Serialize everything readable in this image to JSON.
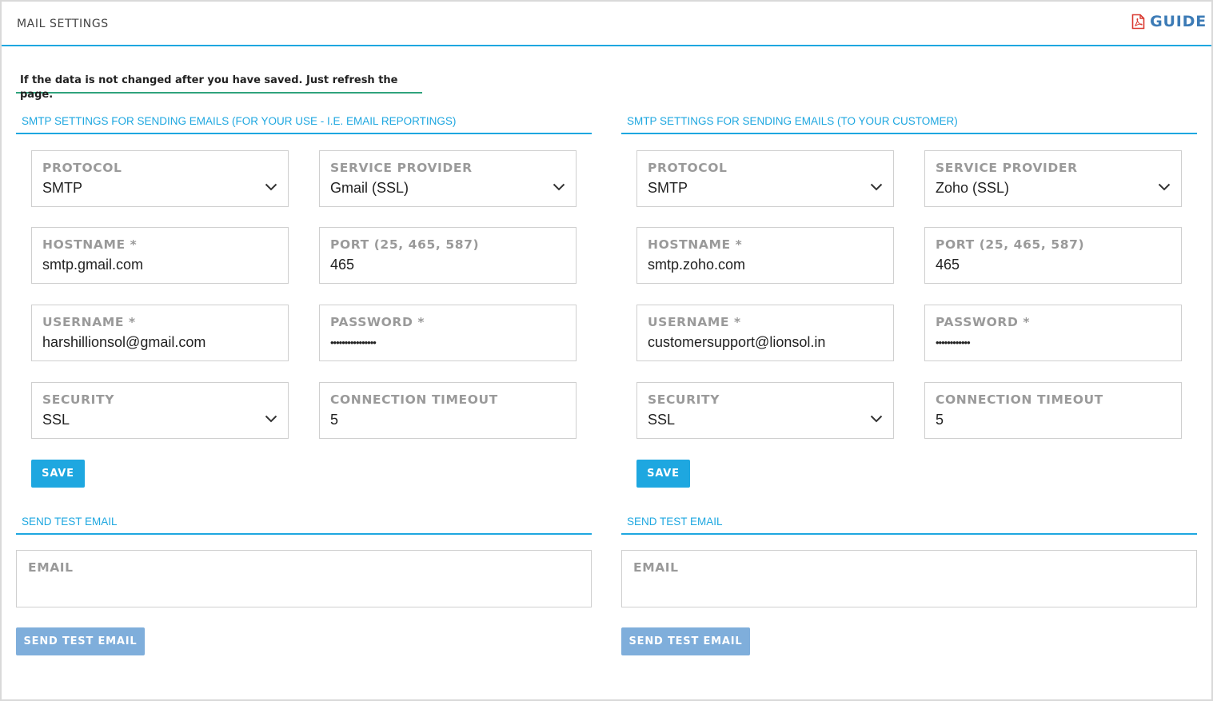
{
  "page": {
    "title": "MAIL SETTINGS",
    "guide_label": "GUIDE",
    "accent": "#1ea7e0",
    "notice_border": "#2fa37c"
  },
  "notice": "If the data is not changed after you have saved. Just refresh the page.",
  "panels": [
    {
      "section_title": "SMTP SETTINGS FOR SENDING EMAILS (FOR YOUR USE - I.E. EMAIL REPORTINGS)",
      "protocol": {
        "label": "PROTOCOL",
        "value": "SMTP"
      },
      "provider": {
        "label": "SERVICE PROVIDER",
        "value": "Gmail (SSL)"
      },
      "hostname": {
        "label": "HOSTNAME *",
        "value": "smtp.gmail.com"
      },
      "port": {
        "label": "PORT (25, 465, 587)",
        "value": "465"
      },
      "username": {
        "label": "USERNAME *",
        "value": "harshillionsol@gmail.com"
      },
      "password": {
        "label": "PASSWORD *",
        "value": "••••••••••••••••"
      },
      "security": {
        "label": "SECURITY",
        "value": "SSL"
      },
      "timeout": {
        "label": "CONNECTION TIMEOUT",
        "value": "5"
      },
      "save_label": "SAVE",
      "test_title": "SEND TEST EMAIL",
      "email_label": "EMAIL",
      "email_value": "",
      "send_label": "SEND TEST EMAIL"
    },
    {
      "section_title": "SMTP SETTINGS FOR SENDING EMAILS (TO YOUR CUSTOMER)",
      "protocol": {
        "label": "PROTOCOL",
        "value": "SMTP"
      },
      "provider": {
        "label": "SERVICE PROVIDER",
        "value": "Zoho (SSL)"
      },
      "hostname": {
        "label": "HOSTNAME *",
        "value": "smtp.zoho.com"
      },
      "port": {
        "label": "PORT (25, 465, 587)",
        "value": "465"
      },
      "username": {
        "label": "USERNAME *",
        "value": "customersupport@lionsol.in"
      },
      "password": {
        "label": "PASSWORD *",
        "value": "••••••••••••"
      },
      "security": {
        "label": "SECURITY",
        "value": "SSL"
      },
      "timeout": {
        "label": "CONNECTION TIMEOUT",
        "value": "5"
      },
      "save_label": "SAVE",
      "test_title": "SEND TEST EMAIL",
      "email_label": "EMAIL",
      "email_value": "",
      "send_label": "SEND TEST EMAIL"
    }
  ],
  "icons": {
    "guide": "pdf-file-icon",
    "select": "chevron-down-icon"
  }
}
